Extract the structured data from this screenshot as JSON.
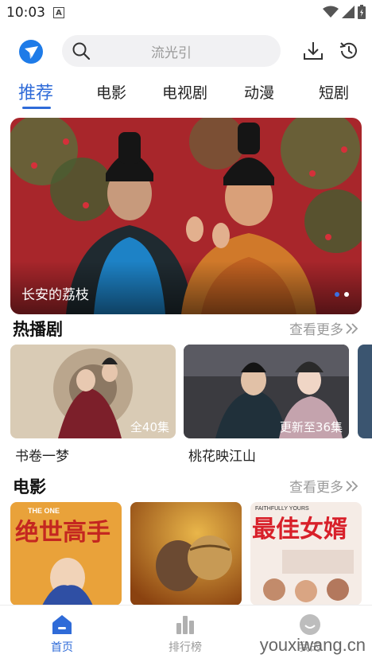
{
  "status": {
    "time": "10:03",
    "a_indicator": "A"
  },
  "search": {
    "placeholder": "流光引"
  },
  "tabs": [
    {
      "label": "推荐",
      "active": true
    },
    {
      "label": "电影"
    },
    {
      "label": "电视剧"
    },
    {
      "label": "动漫"
    },
    {
      "label": "短剧"
    }
  ],
  "banner": {
    "title": "长安的荔枝",
    "page_count": 2,
    "current_page": 1
  },
  "hot": {
    "title": "热播剧",
    "more": "查看更多",
    "items": [
      {
        "name": "书卷一梦",
        "badge": "全40集"
      },
      {
        "name": "桃花映江山",
        "badge": "更新至36集"
      }
    ]
  },
  "movies": {
    "title": "电影",
    "more": "查看更多",
    "poster_texts": [
      "绝世高手",
      "THE ONE",
      "最佳女婿",
      "FAITHFULLY YOURS"
    ]
  },
  "nav": {
    "items": [
      {
        "label": "首页",
        "active": true
      },
      {
        "label": "排行榜"
      },
      {
        "label": "我的"
      }
    ]
  },
  "watermark": "youxiwang.cn",
  "colors": {
    "accent": "#2f6bd8",
    "muted": "#9a9a9a"
  }
}
